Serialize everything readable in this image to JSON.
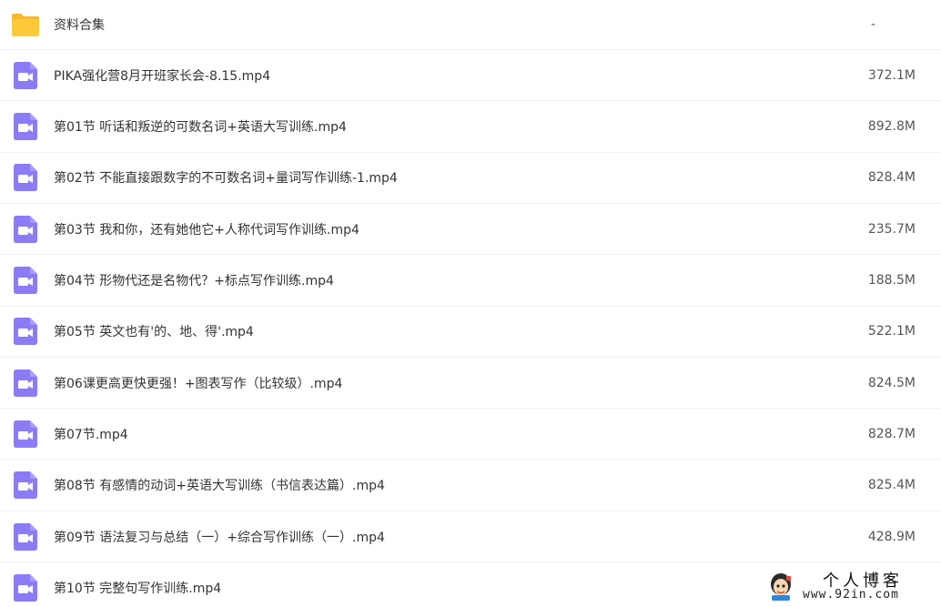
{
  "files": [
    {
      "name": "资料合集",
      "size": "-",
      "type": "folder"
    },
    {
      "name": "PIKA强化营8月开班家长会-8.15.mp4",
      "size": "372.1M",
      "type": "video"
    },
    {
      "name": "第01节 听话和叛逆的可数名词+英语大写训练.mp4",
      "size": "892.8M",
      "type": "video"
    },
    {
      "name": "第02节 不能直接跟数字的不可数名词+量词写作训练-1.mp4",
      "size": "828.4M",
      "type": "video"
    },
    {
      "name": "第03节 我和你，还有她他它+人称代词写作训练.mp4",
      "size": "235.7M",
      "type": "video"
    },
    {
      "name": "第04节 形物代还是名物代？+标点写作训练.mp4",
      "size": "188.5M",
      "type": "video"
    },
    {
      "name": "第05节 英文也有'的、地、得'.mp4",
      "size": "522.1M",
      "type": "video"
    },
    {
      "name": "第06课更高更快更强！+图表写作（比较级）.mp4",
      "size": "824.5M",
      "type": "video"
    },
    {
      "name": "第07节.mp4",
      "size": "828.7M",
      "type": "video"
    },
    {
      "name": "第08节 有感情的动词+英语大写训练（书信表达篇）.mp4",
      "size": "825.4M",
      "type": "video"
    },
    {
      "name": "第09节 语法复习与总结（一）+综合写作训练（一）.mp4",
      "size": "428.9M",
      "type": "video"
    },
    {
      "name": "第10节 完整句写作训练.mp4",
      "size": "",
      "type": "video"
    }
  ],
  "icons": {
    "folder": "folder-icon",
    "video": "video-file-icon"
  },
  "colors": {
    "folder": "#FFC93C",
    "folder_tab": "#F5B92A",
    "video_bg": "#8B7CF6",
    "text": "#333333",
    "size_text": "#555555",
    "divider": "#F1F2F4"
  },
  "watermark": {
    "title": "个人博客",
    "url": "www.92in.com"
  }
}
